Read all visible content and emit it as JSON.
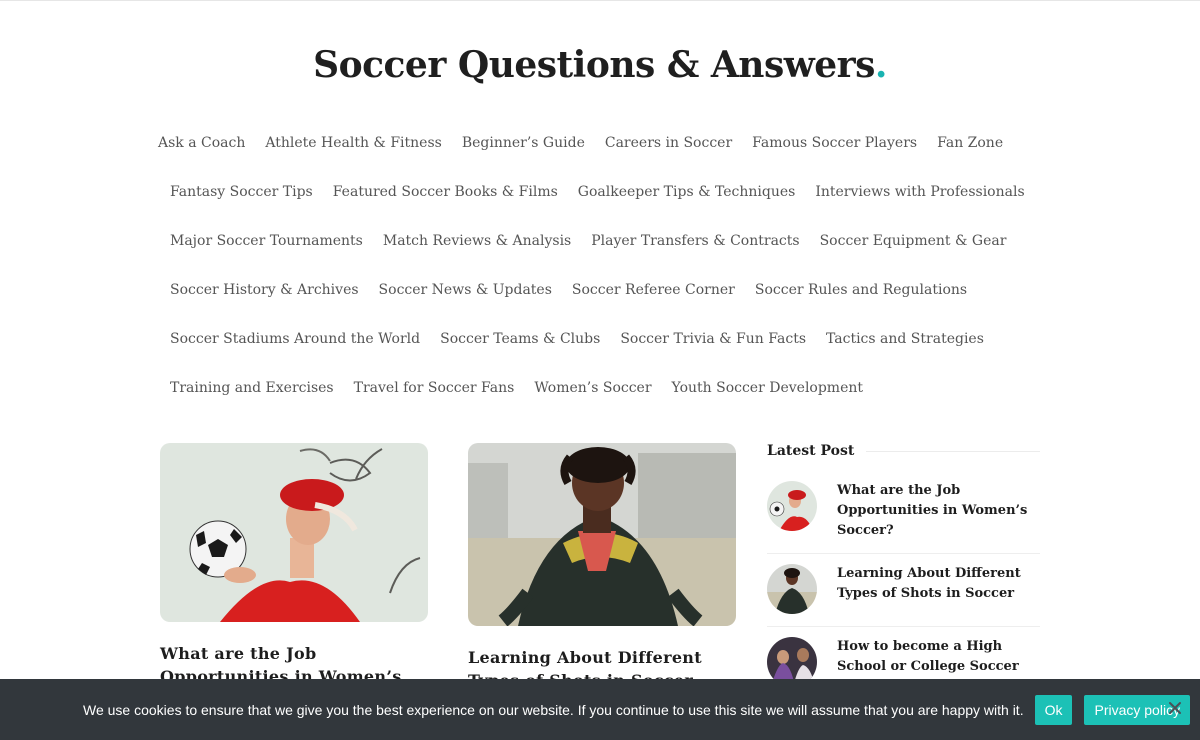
{
  "site": {
    "title": "Soccer Questions & Answers",
    "title_dot": ".",
    "accent_color": "#19b3b1"
  },
  "nav": {
    "rows": [
      [
        "Ask a Coach",
        "Athlete Health & Fitness",
        "Beginner’s Guide",
        "Careers in Soccer",
        "Famous Soccer Players",
        "Fan Zone"
      ],
      [
        "Fantasy Soccer Tips",
        "Featured Soccer Books & Films",
        "Goalkeeper Tips & Techniques",
        "Interviews with Professionals"
      ],
      [
        "Major Soccer Tournaments",
        "Match Reviews & Analysis",
        "Player Transfers & Contracts",
        "Soccer Equipment & Gear"
      ],
      [
        "Soccer History & Archives",
        "Soccer News & Updates",
        "Soccer Referee Corner",
        "Soccer Rules and Regulations"
      ],
      [
        "Soccer Stadiums Around the World",
        "Soccer Teams & Clubs",
        "Soccer Trivia & Fun Facts",
        "Tactics and Strategies"
      ],
      [
        "Training and Exercises",
        "Travel for Soccer Fans",
        "Women’s Soccer",
        "Youth Soccer Development"
      ]
    ]
  },
  "articles": [
    {
      "title": "What are the Job Opportunities in Women’s Soccer?"
    },
    {
      "title": "Learning About Different Types of Shots in Soccer"
    }
  ],
  "sidebar": {
    "heading": "Latest Post",
    "posts": [
      {
        "title": "What are the Job Opportunities in Women’s Soccer?"
      },
      {
        "title": "Learning About Different Types of Shots in Soccer"
      },
      {
        "title": "How to become a High School or College Soccer Coach?"
      }
    ]
  },
  "cookie_banner": {
    "text": "We use cookies to ensure that we give you the best experience on our website. If you continue to use this site we will assume that you are happy with it.",
    "ok_label": "Ok",
    "privacy_label": "Privacy policy",
    "button_color": "#1cc1b6",
    "background_color": "#32373c"
  },
  "icons": {
    "close": "close-icon"
  }
}
